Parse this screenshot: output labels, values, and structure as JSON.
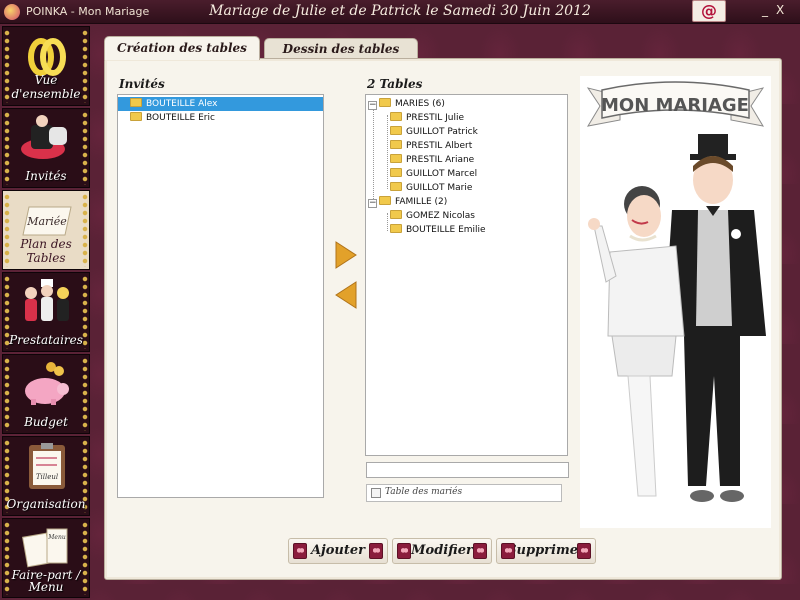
{
  "titlebar": {
    "app_title": "POINKA - Mon Mariage",
    "window_title": "Mariage de Julie et de Patrick le Samedi 30 Juin 2012",
    "minimize": "_",
    "close": "X",
    "mail_icon": "@"
  },
  "sidebar": {
    "items": [
      {
        "label": "Vue d'ensemble",
        "icon": "rings-icon"
      },
      {
        "label": "Invités",
        "icon": "couple-icon"
      },
      {
        "label": "Plan des Tables",
        "icon": "place-card-icon",
        "card_text": "Mariée"
      },
      {
        "label": "Prestataires",
        "icon": "vendors-icon"
      },
      {
        "label": "Budget",
        "icon": "piggy-bank-icon"
      },
      {
        "label": "Organisation",
        "icon": "clipboard-icon",
        "clip_text": "Tilleul"
      },
      {
        "label": "Faire-part / Menu",
        "icon": "invitation-icon",
        "card_text": "Menu"
      }
    ]
  },
  "tabs": [
    {
      "label": "Création des tables",
      "active": true
    },
    {
      "label": "Dessin des tables",
      "active": false
    }
  ],
  "guests": {
    "title": "Invités",
    "items": [
      {
        "label": "BOUTEILLE Alex",
        "selected": true
      },
      {
        "label": "BOUTEILLE Eric",
        "selected": false
      }
    ]
  },
  "tables": {
    "title": "2 Tables",
    "groups": [
      {
        "label": "MARIES (6)",
        "members": [
          "PRESTIL Julie",
          "GUILLOT Patrick",
          "PRESTIL Albert",
          "PRESTIL Ariane",
          "GUILLOT Marcel",
          "GUILLOT Marie"
        ]
      },
      {
        "label": "FAMILLE (2)",
        "members": [
          "GOMEZ Nicolas",
          "BOUTEILLE Emilie"
        ]
      }
    ],
    "table_name_value": "",
    "checkbox_label": "Table des mariés",
    "checkbox_checked": false
  },
  "illustration": {
    "banner_text": "MON MARIAGE"
  },
  "actions": {
    "add": "Ajouter",
    "edit": "Modifier",
    "delete": "Supprimer"
  },
  "colors": {
    "accent": "#8a1c3c",
    "selection": "#3399dd",
    "sidebar_dots": "#d8b24a",
    "folder": "#f1c94b"
  }
}
